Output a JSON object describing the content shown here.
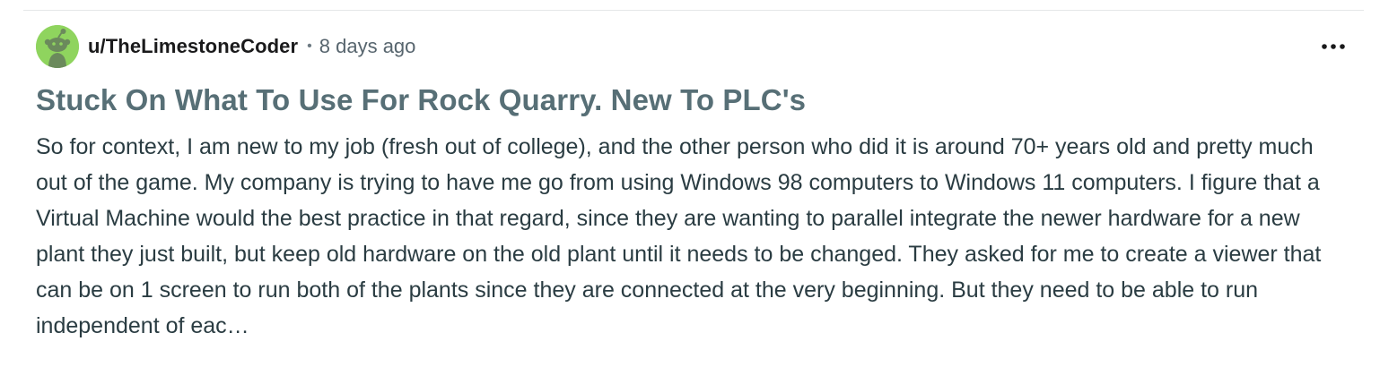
{
  "post": {
    "author": "u/TheLimestoneCoder",
    "separator": "•",
    "time_ago": "8 days ago",
    "title": "Stuck On What To Use For Rock Quarry. New To PLC's",
    "body": "So for context, I am new to my job (fresh out of college), and the other person who did it is around 70+ years old and pretty much out of the game. My company is trying to have me go from using Windows 98 computers to Windows 11 computers. I figure that a Virtual Machine would the best practice in that regard, since they are wanting to parallel integrate the newer hardware for a new plant they just built, but keep old hardware on the old plant until it needs to be changed. They asked for me to create a viewer that can be on 1 screen to run both of the plants since they are connected at the very beginning. But they need to be able to run independent of eac…",
    "avatar_icon": "snoo-avatar-icon",
    "more_icon": "more-options-icon"
  },
  "colors": {
    "avatar_bg": "#8fd45e",
    "title": "#576f76",
    "body": "#2a3c42",
    "meta": "#57656e"
  }
}
